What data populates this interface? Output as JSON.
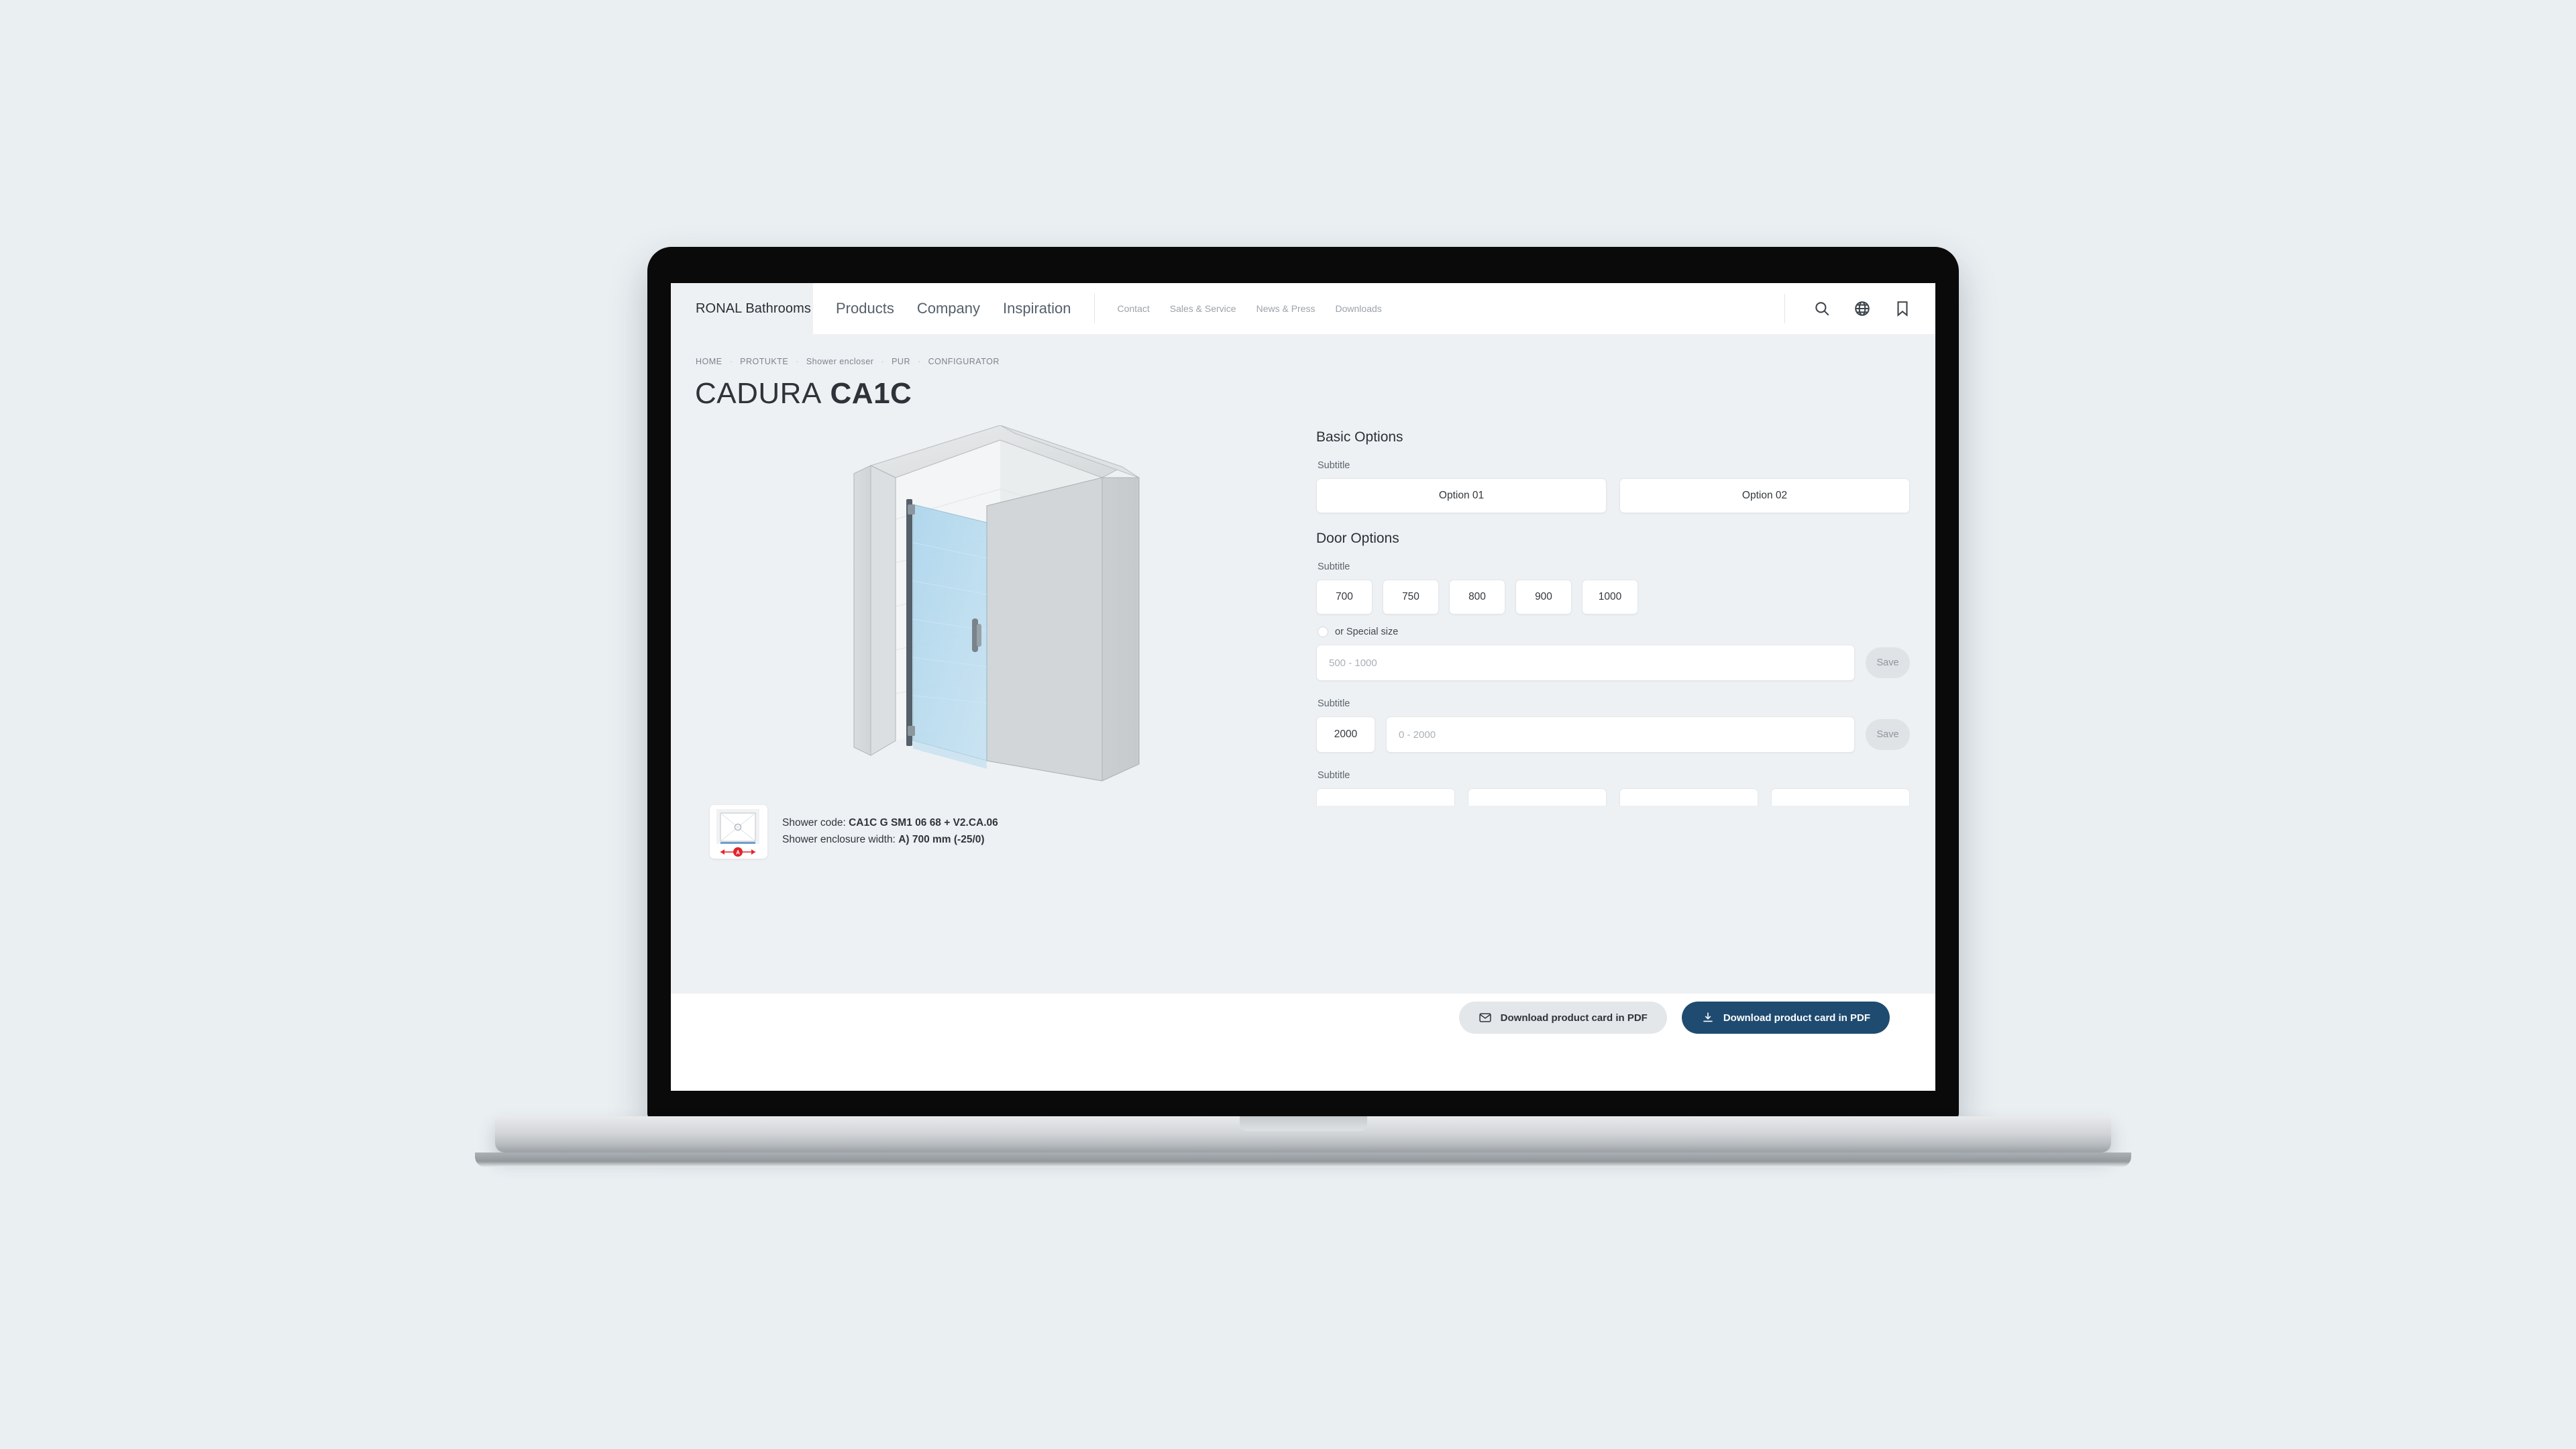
{
  "brand": {
    "name": "RONAL Bathrooms"
  },
  "nav": {
    "main": [
      {
        "label": "Products"
      },
      {
        "label": "Company"
      },
      {
        "label": "Inspiration"
      }
    ],
    "secondary": [
      {
        "label": "Contact"
      },
      {
        "label": "Sales & Service"
      },
      {
        "label": "News & Press"
      },
      {
        "label": "Downloads"
      }
    ],
    "icons": [
      {
        "name": "search-icon"
      },
      {
        "name": "globe-icon"
      },
      {
        "name": "bookmark-icon"
      }
    ]
  },
  "breadcrumb": {
    "items": [
      "HOME",
      "PROTUKTE",
      "Shower encloser",
      "PUR",
      "CONFIGURATOR"
    ],
    "separator": "·"
  },
  "page_title": {
    "thin": "CADURA",
    "bold": "CA1C"
  },
  "product_info": {
    "shower_code_label": "Shower code:",
    "shower_code_value": "CA1C G SM1 06 68 + V2.CA.06",
    "width_label": "Shower enclosure width:",
    "width_value": "A) 700 mm (-25/0)",
    "thumbnail_name": "floor-plan-thumbnail",
    "dimension_letter": "A"
  },
  "panel": {
    "sections": [
      {
        "title": "Basic Options",
        "subtitle": "Subtitle",
        "options": [
          {
            "label": "Option 01"
          },
          {
            "label": "Option 02"
          }
        ]
      },
      {
        "title": "Door Options",
        "subtitle": "Subtitle",
        "sizes": [
          "700",
          "750",
          "800",
          "900",
          "1000"
        ],
        "special": {
          "radio_label": "or Special size",
          "placeholder": "500 - 1000",
          "save_label": "Save"
        }
      }
    ],
    "height_section": {
      "subtitle": "Subtitle",
      "fixed_value": "2000",
      "placeholder": "0 - 2000",
      "save_label": "Save"
    },
    "last_subtitle": "Subtitle"
  },
  "footer": {
    "buttons": [
      {
        "label": "Download product card in PDF",
        "icon": "envelope-icon",
        "style": "light"
      },
      {
        "label": "Download product card in PDF",
        "icon": "download-icon",
        "style": "dark"
      }
    ]
  },
  "colors": {
    "page_bg": "#eef1f4",
    "desk_bg": "#eaeff2",
    "accent_dark": "#1f4b70",
    "glass_blue": "#bbdcef",
    "dimension_red": "#e0242c"
  }
}
